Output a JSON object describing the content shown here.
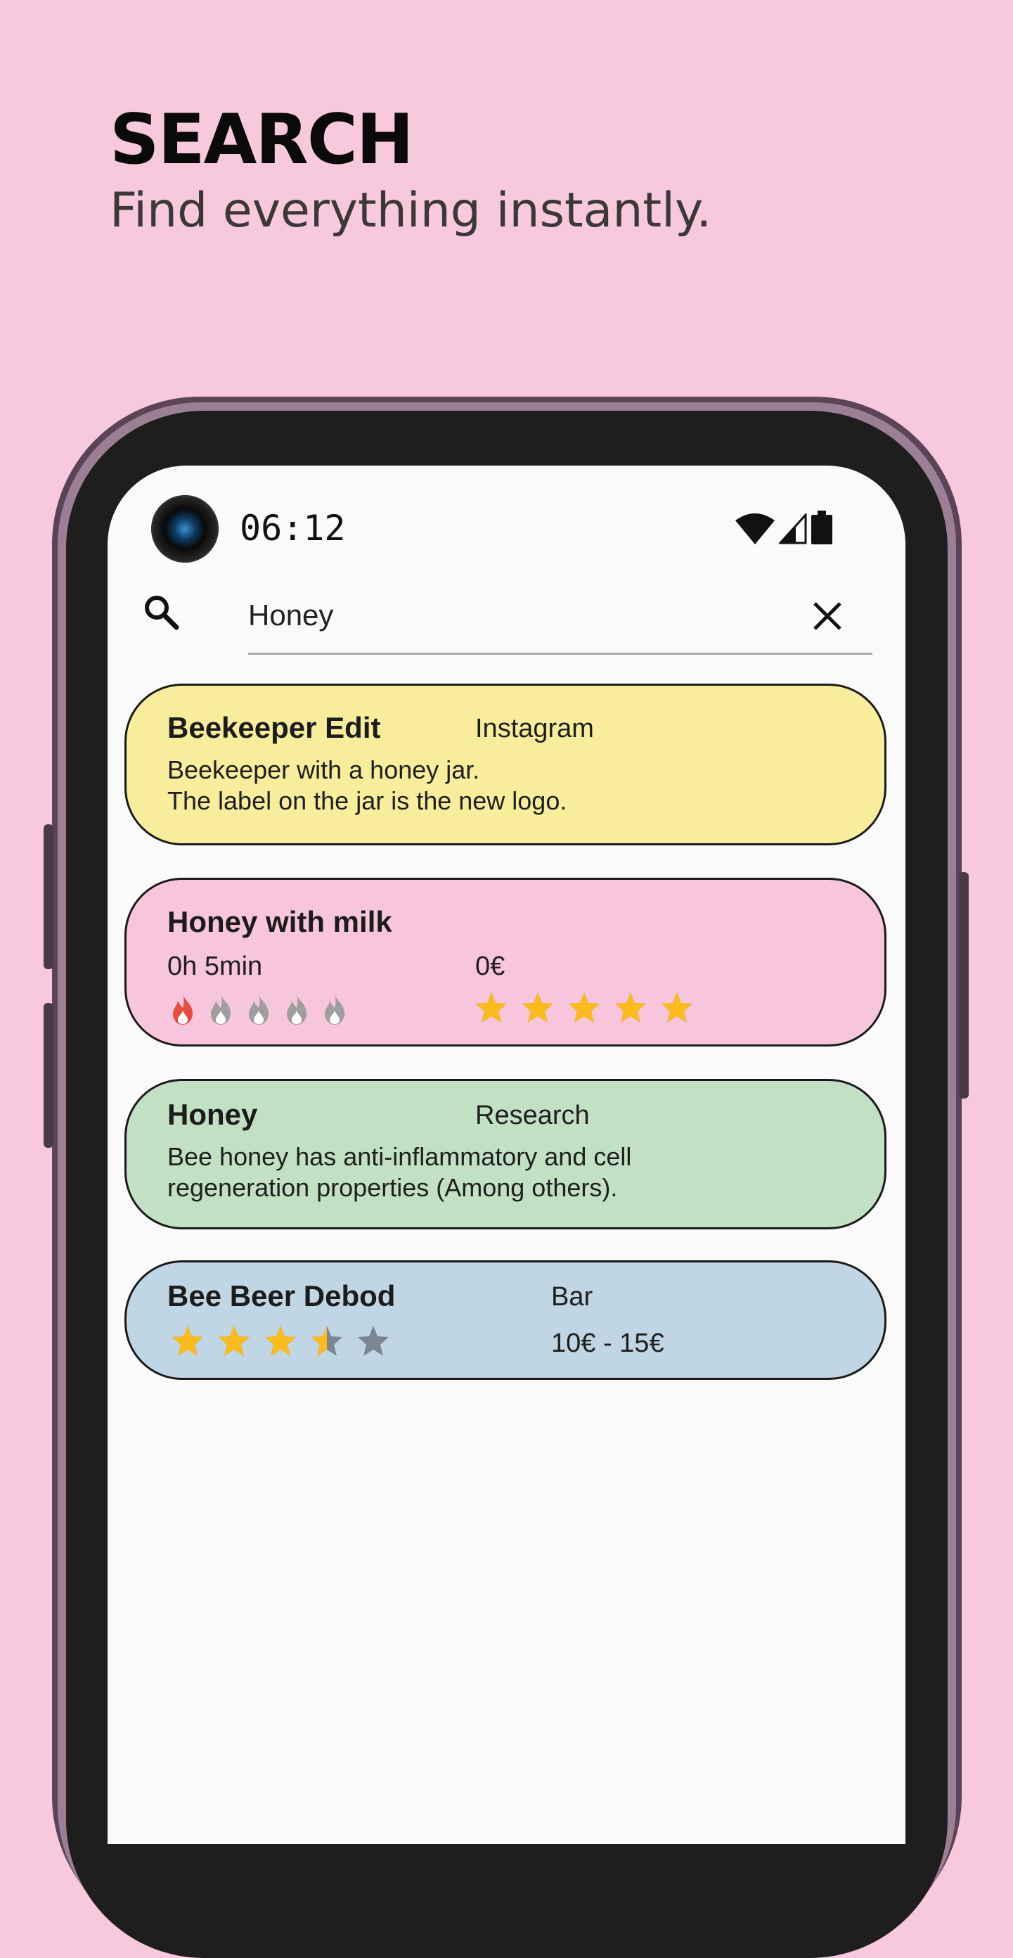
{
  "header": {
    "title": "SEARCH",
    "subtitle": "Find everything instantly."
  },
  "status_bar": {
    "time": "06:12"
  },
  "search": {
    "query": "Honey",
    "placeholder": ""
  },
  "results": [
    {
      "title": "Beekeeper Edit",
      "tag": "Instagram",
      "description": "Beekeeper with a honey jar.\nThe label on the jar is the new logo.",
      "color": "#f7ed9b"
    },
    {
      "title": "Honey with milk",
      "duration": "0h 5min",
      "price": "0€",
      "difficulty": 1,
      "difficulty_max": 5,
      "rating": 5,
      "rating_max": 5,
      "color": "#f8c6dc"
    },
    {
      "title": "Honey",
      "tag": "Research",
      "description": "Bee honey has anti-inflammatory and cell\nregeneration properties (Among others).",
      "color": "#c1e0c4"
    },
    {
      "title": "Bee Beer Debod",
      "tag": "Bar",
      "price_range": "10€ - 15€",
      "rating": 3.5,
      "rating_max": 5,
      "color": "#c0d6e4"
    }
  ],
  "colors": {
    "background": "#f8c8dc",
    "star_active": "#fbbb1a",
    "star_inactive": "#7b8692",
    "flame_active": "#e74c3c",
    "flame_inactive": "#9e9e9e"
  }
}
